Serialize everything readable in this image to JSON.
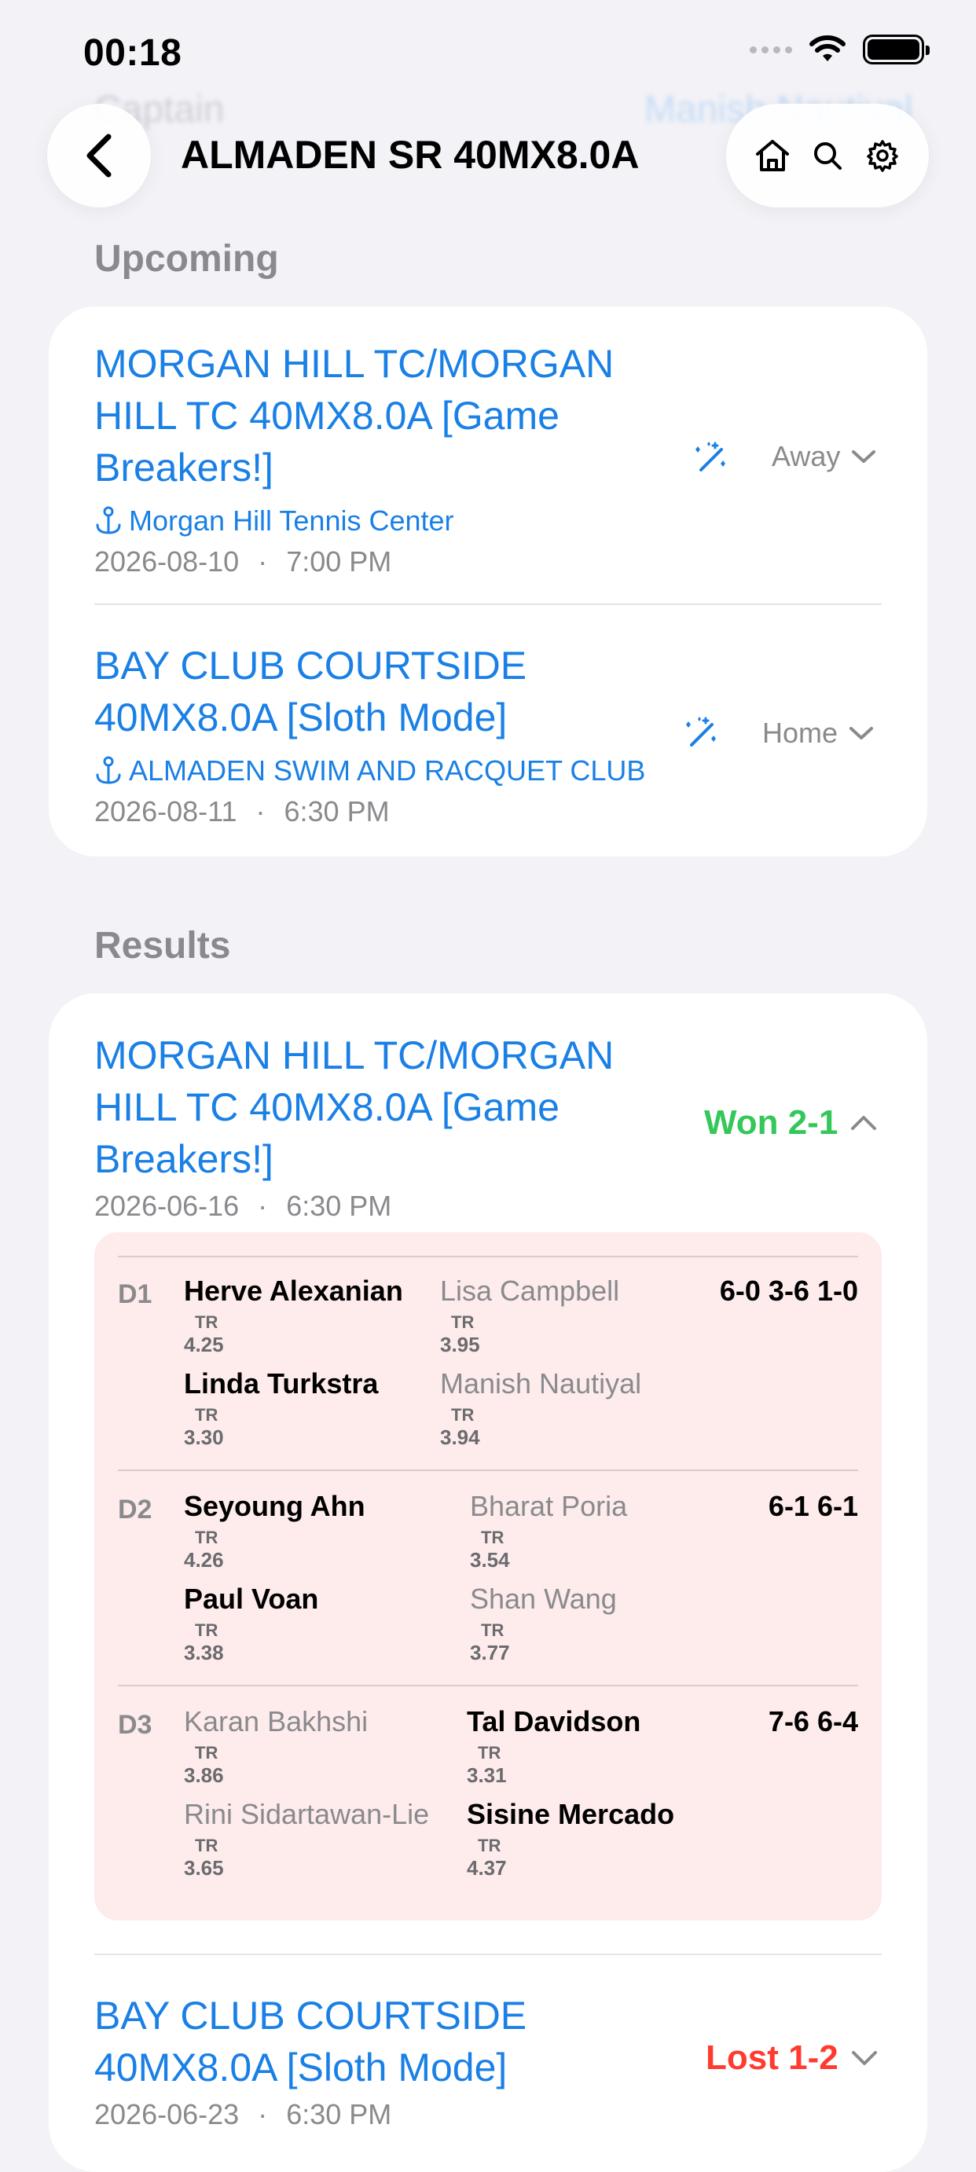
{
  "status": {
    "time": "00:18"
  },
  "ghost_header": {
    "left": "Captain",
    "right": "Manish Nautiyal"
  },
  "nav": {
    "title": "ALMADEN SR 40MX8.0A"
  },
  "sections": {
    "upcoming": "Upcoming",
    "results": "Results"
  },
  "upcoming": [
    {
      "title_lines": [
        "MORGAN HILL TC/MORGAN",
        "HILL TC 40MX8.0A [Game",
        "Breakers!]"
      ],
      "venue": "Morgan Hill Tennis Center",
      "date": "2026-08-10",
      "time": "7:00 PM",
      "side": "Away"
    },
    {
      "title_lines": [
        "BAY CLUB COURTSIDE",
        "40MX8.0A [Sloth Mode]"
      ],
      "venue": "ALMADEN SWIM AND RACQUET CLUB",
      "date": "2026-08-11",
      "time": "6:30 PM",
      "side": "Home"
    }
  ],
  "results": [
    {
      "title_lines": [
        "MORGAN HILL TC/MORGAN",
        "HILL TC 40MX8.0A [Game",
        "Breakers!]"
      ],
      "date": "2026-06-16",
      "time": "6:30 PM",
      "outcome": "Won 2-1",
      "lines": [
        {
          "code": "D1",
          "score": "6-0 3-6 1-0",
          "left": [
            {
              "name": "Herve Alexanian",
              "tr": "4.25"
            },
            {
              "name": "Linda Turkstra",
              "tr": "3.30"
            }
          ],
          "right": [
            {
              "name": "Lisa Campbell",
              "tr": "3.95"
            },
            {
              "name": "Manish Nautiyal",
              "tr": "3.94"
            }
          ]
        },
        {
          "code": "D2",
          "score": "6-1 6-1",
          "left": [
            {
              "name": "Seyoung Ahn",
              "tr": "4.26"
            },
            {
              "name": "Paul Voan",
              "tr": "3.38"
            }
          ],
          "right": [
            {
              "name": "Bharat Poria",
              "tr": "3.54"
            },
            {
              "name": "Shan Wang",
              "tr": "3.77"
            }
          ]
        },
        {
          "code": "D3",
          "score": "7-6 6-4",
          "left": [
            {
              "name": "Karan Bakhshi",
              "tr": "3.86"
            },
            {
              "name": "Rini Sidartawan-Lie",
              "tr": "3.65"
            }
          ],
          "right": [
            {
              "name": "Tal Davidson",
              "tr": "3.31"
            },
            {
              "name": "Sisine Mercado",
              "tr": "4.37"
            }
          ]
        }
      ]
    },
    {
      "title_lines": [
        "BAY CLUB COURTSIDE",
        "40MX8.0A [Sloth Mode]"
      ],
      "date": "2026-06-23",
      "time": "6:30 PM",
      "outcome": "Lost 1-2"
    }
  ],
  "labels": {
    "tr": "TR",
    "dot": "·"
  },
  "colors": {
    "link": "#1a80e5",
    "win": "#34c759",
    "loss": "#ff3b30",
    "score_bg": "#fdeceb"
  }
}
